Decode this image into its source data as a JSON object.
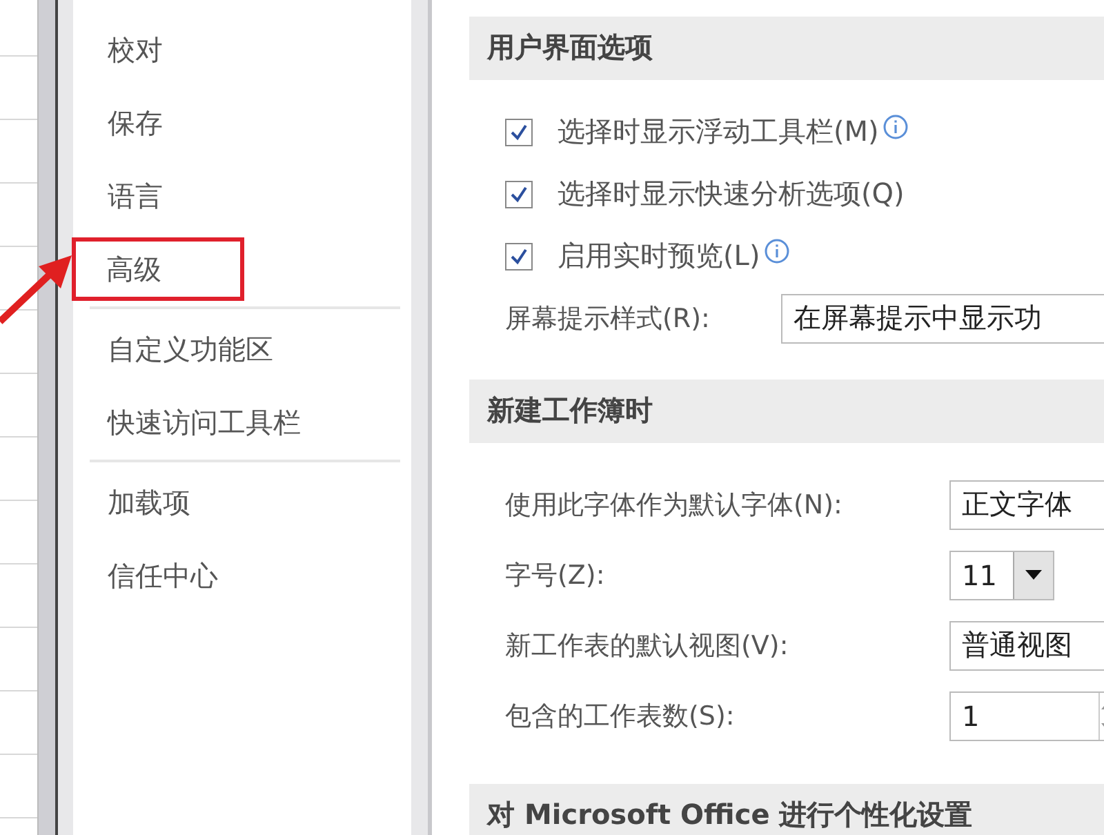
{
  "sidebar": {
    "groups": [
      {
        "items": [
          {
            "label": "校对",
            "highlighted": false
          },
          {
            "label": "保存",
            "highlighted": false
          },
          {
            "label": "语言",
            "highlighted": false
          },
          {
            "label": "高级",
            "highlighted": true
          }
        ]
      },
      {
        "items": [
          {
            "label": "自定义功能区",
            "highlighted": false
          },
          {
            "label": "快速访问工具栏",
            "highlighted": false
          }
        ]
      },
      {
        "items": [
          {
            "label": "加载项",
            "highlighted": false
          },
          {
            "label": "信任中心",
            "highlighted": false
          }
        ]
      }
    ]
  },
  "sections": [
    {
      "title": "用户界面选项",
      "rows": [
        {
          "kind": "checkbox",
          "label": "选择时显示浮动工具栏(M)",
          "checked": true,
          "info": true
        },
        {
          "kind": "checkbox",
          "label": "选择时显示快速分析选项(Q)",
          "checked": true,
          "info": false
        },
        {
          "kind": "checkbox",
          "label": "启用实时预览(L)",
          "checked": true,
          "info": true
        },
        {
          "kind": "select",
          "label": "屏幕提示样式(R):",
          "value": "在屏幕提示中显示功"
        }
      ]
    },
    {
      "title": "新建工作簿时",
      "rows": [
        {
          "kind": "select",
          "label": "使用此字体作为默认字体(N):",
          "value": "正文字体"
        },
        {
          "kind": "combo",
          "label": "字号(Z):",
          "value": "11"
        },
        {
          "kind": "select",
          "label": "新工作表的默认视图(V):",
          "value": "普通视图"
        },
        {
          "kind": "spinner",
          "label": "包含的工作表数(S):",
          "value": "1"
        }
      ]
    },
    {
      "title": "对 Microsoft Office 进行个性化设置"
    }
  ]
}
